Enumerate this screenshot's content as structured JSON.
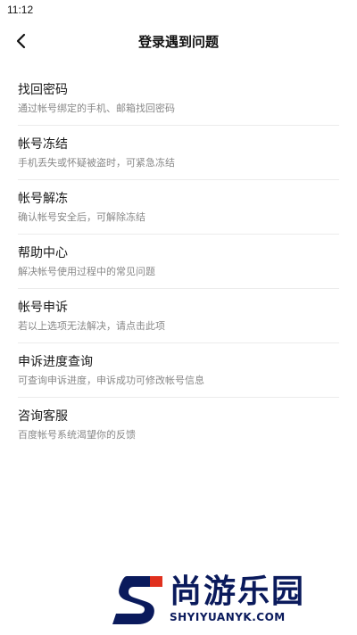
{
  "status_bar": {
    "time": "11:12"
  },
  "nav": {
    "title": "登录遇到问题",
    "back_icon": "chevron-left-icon"
  },
  "menu": {
    "items": [
      {
        "title": "找回密码",
        "desc": "通过帐号绑定的手机、邮箱找回密码"
      },
      {
        "title": "帐号冻结",
        "desc": "手机丢失或怀疑被盗时，可紧急冻结"
      },
      {
        "title": "帐号解冻",
        "desc": "确认帐号安全后，可解除冻结"
      },
      {
        "title": "帮助中心",
        "desc": "解决帐号使用过程中的常见问题"
      },
      {
        "title": "帐号申诉",
        "desc": "若以上选项无法解决，请点击此项"
      },
      {
        "title": "申诉进度查询",
        "desc": "可查询申诉进度，申诉成功可修改帐号信息"
      },
      {
        "title": "咨询客服",
        "desc": "百度帐号系统渴望你的反馈"
      }
    ]
  },
  "watermark": {
    "cn": "尚游乐园",
    "en": "SHYIYUANYK.COM",
    "colors": {
      "dark": "#0a1a5c",
      "red": "#e0301e"
    }
  }
}
